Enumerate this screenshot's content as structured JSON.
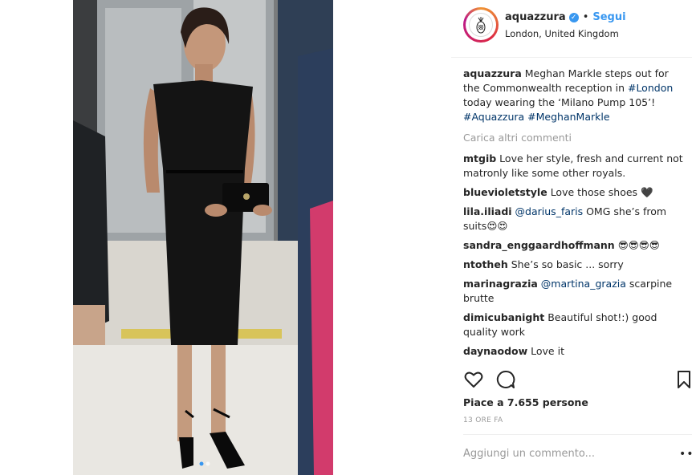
{
  "post": {
    "photo_alt": "Photo",
    "carousel_dots": 2
  },
  "header": {
    "username": "aquazzura",
    "verified_glyph": "✓",
    "separator": "•",
    "follow_label": "Segui",
    "location": "London, United Kingdom"
  },
  "caption": {
    "username": "aquazzura",
    "text_1": "Meghan Markle steps out for the Commonwealth reception in ",
    "hashtag_london": "#London",
    "text_2": " today wearing the ‘Milano Pump 105’!",
    "hashtag_aquazzura": "#Aquazzura",
    "hashtag_meghan": "#MeghanMarkle"
  },
  "load_more_label": "Carica altri commenti",
  "comments": [
    {
      "username": "mtgib",
      "text": "Love her style, fresh and current not matronly like some other royals."
    },
    {
      "username": "bluevioletstyle",
      "text": "Love those shoes 🖤"
    },
    {
      "username": "lila.iliadi",
      "mention": "@darius_faris",
      "text": " OMG she’s from suits😍😍"
    },
    {
      "username": "sandra_enggaardhoffmann",
      "text": "😎😎😎😎"
    },
    {
      "username": "ntotheh",
      "text": "She’s so basic ... sorry"
    },
    {
      "username": "marinagrazia",
      "mention": "@martina_grazia",
      "text": " scarpine brutte"
    },
    {
      "username": "dimicubanight",
      "text": "Beautiful shot!:) good quality work"
    },
    {
      "username": "daynaodow",
      "text": "Love it"
    }
  ],
  "icons": {
    "like": "heart-icon",
    "comment": "comment-icon",
    "save": "bookmark-icon",
    "more": "more-options-icon"
  },
  "likes_label": "Piace a 7.655 persone",
  "time_label": "13 ORE FA",
  "add_comment_placeholder": "Aggiungi un commento...",
  "more_glyph": "•••",
  "colors": {
    "accent": "#3897f0",
    "link": "#003569",
    "muted": "#999999",
    "text": "#262626"
  }
}
